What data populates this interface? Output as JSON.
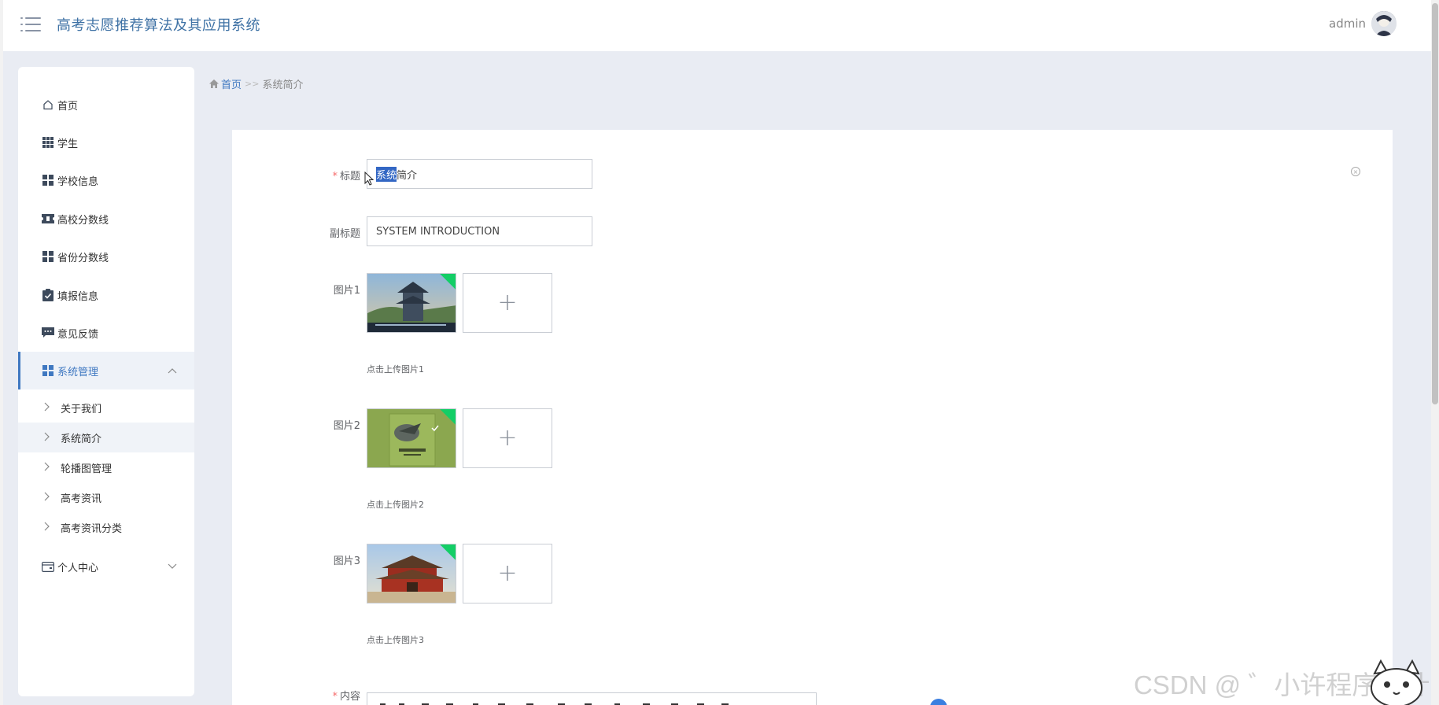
{
  "app": {
    "title": "高考志愿推荐算法及其应用系统",
    "user": "admin"
  },
  "colors": {
    "accent": "#3f78c1",
    "title": "#3f72a5",
    "background": "#e9ecf3",
    "badge_green": "#13ce66",
    "required": "#f56c6c"
  },
  "sidebar": {
    "items": [
      {
        "label": "首页",
        "icon": "home-icon"
      },
      {
        "label": "学生",
        "icon": "grid-icon"
      },
      {
        "label": "学校信息",
        "icon": "grid-icon"
      },
      {
        "label": "高校分数线",
        "icon": "ticket-icon"
      },
      {
        "label": "省份分数线",
        "icon": "grid-icon"
      },
      {
        "label": "填报信息",
        "icon": "clipboard-check-icon"
      },
      {
        "label": "意见反馈",
        "icon": "message-icon"
      },
      {
        "label": "系统管理",
        "icon": "grid-icon",
        "expanded": true
      },
      {
        "label": "个人中心",
        "icon": "card-icon",
        "expanded": false
      }
    ],
    "sub_items": [
      {
        "label": "关于我们"
      },
      {
        "label": "系统简介",
        "current": true
      },
      {
        "label": "轮播图管理"
      },
      {
        "label": "高考资讯"
      },
      {
        "label": "高考资讯分类"
      }
    ]
  },
  "breadcrumb": {
    "home": "首页",
    "separator": ">>",
    "current": "系统简介"
  },
  "form": {
    "title_label": "标题",
    "title_value_selected": "系统",
    "title_value_rest": "简介",
    "subtitle_label": "副标题",
    "subtitle_value": "SYSTEM INTRODUCTION",
    "image1_label": "图片1",
    "image1_hint": "点击上传图片1",
    "image2_label": "图片2",
    "image2_hint": "点击上传图片2",
    "image3_label": "图片3",
    "image3_hint": "点击上传图片3",
    "content_label": "内容",
    "required_mark": "*",
    "upload_plus": "+"
  },
  "watermark": "CSDN @ ゛小许程序设计"
}
